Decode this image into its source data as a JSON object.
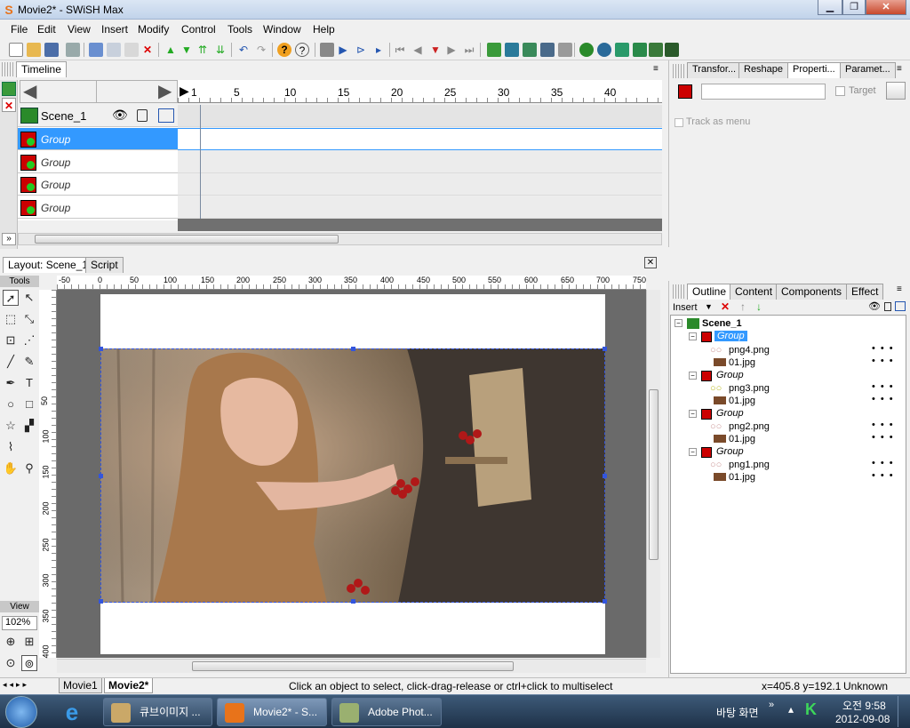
{
  "window": {
    "title": "Movie2* - SWiSH Max"
  },
  "menu": [
    "File",
    "Edit",
    "View",
    "Insert",
    "Modify",
    "Control",
    "Tools",
    "Window",
    "Help"
  ],
  "timeline": {
    "tab": "Timeline",
    "ruler": [
      "1",
      "5",
      "10",
      "15",
      "20",
      "25",
      "30",
      "35",
      "40"
    ],
    "scene": "Scene_1",
    "rows": [
      "Group",
      "Group",
      "Group",
      "Group"
    ]
  },
  "props_tabs": [
    "Transfor...",
    "Reshape",
    "Properti...",
    "Paramet..."
  ],
  "props": {
    "target_label": "Target",
    "track_label": "Track as menu"
  },
  "layout_tabs": [
    "Layout: Scene_1",
    "Script"
  ],
  "h_ruler": [
    "-50",
    "0",
    "50",
    "100",
    "150",
    "200",
    "250",
    "300",
    "350",
    "400",
    "450",
    "500",
    "550",
    "600",
    "650",
    "700",
    "750"
  ],
  "v_ruler": [
    "50",
    "100",
    "150",
    "200",
    "250",
    "300",
    "350",
    "400"
  ],
  "tools_label": "Tools",
  "view_label": "View",
  "zoom": "102%",
  "outline_tabs": [
    "Outline",
    "Content",
    "Components",
    "Effect"
  ],
  "outline_insert": "Insert",
  "outline_tree": {
    "scene": "Scene_1",
    "groups": [
      {
        "name": "Group",
        "items": [
          "png4.png",
          "01.jpg"
        ]
      },
      {
        "name": "Group",
        "items": [
          "png3.png",
          "01.jpg"
        ]
      },
      {
        "name": "Group",
        "items": [
          "png2.png",
          "01.jpg"
        ]
      },
      {
        "name": "Group",
        "items": [
          "png1.png",
          "01.jpg"
        ]
      }
    ]
  },
  "movie_tabs": [
    "Movie1",
    "Movie2*"
  ],
  "status": {
    "hint": "Click an object to select, click-drag-release or ctrl+click to multiselect",
    "coords": "x=405.8 y=192.1",
    "size": "Unknown Size"
  },
  "taskbar": {
    "items": [
      "큐브이미지 ...",
      "Movie2* - S...",
      "Adobe Phot..."
    ],
    "desktop": "바탕 화면",
    "time": "오전 9:58",
    "date": "2012-09-08"
  }
}
